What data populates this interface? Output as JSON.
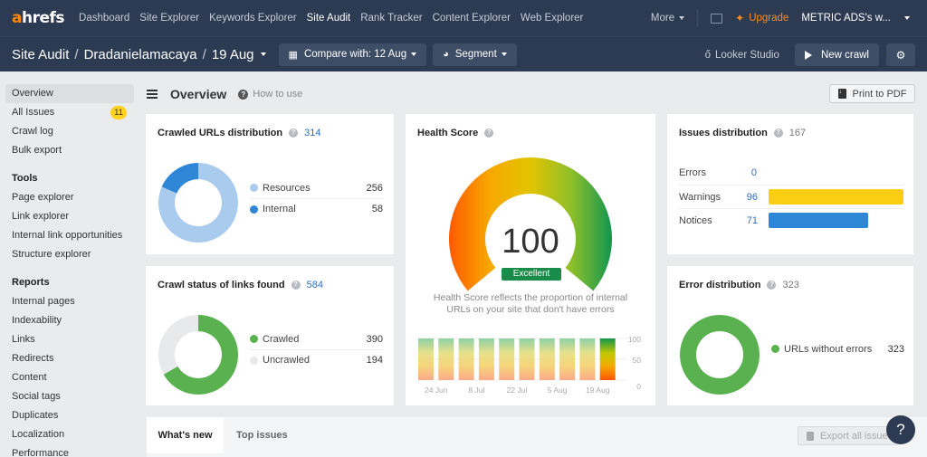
{
  "nav": {
    "logo": {
      "accent": "a",
      "rest": "hrefs"
    },
    "links": [
      "Dashboard",
      "Site Explorer",
      "Keywords Explorer",
      "Site Audit",
      "Rank Tracker",
      "Content Explorer",
      "Web Explorer"
    ],
    "active_link": "Site Audit",
    "more": "More",
    "upgrade": "Upgrade",
    "account": "METRIC ADS's w..."
  },
  "subheader": {
    "breadcrumbs": [
      "Site Audit",
      "Dradanielamacaya",
      "19 Aug"
    ],
    "compare_button": "Compare with: 12 Aug",
    "segment_button": "Segment",
    "looker_studio": "Looker Studio",
    "new_crawl_button": "New crawl"
  },
  "sidebar": {
    "items": [
      {
        "label": "Overview",
        "active": true
      },
      {
        "label": "All Issues",
        "badge": "11"
      },
      {
        "label": "Crawl log"
      },
      {
        "label": "Bulk export"
      }
    ],
    "tools_heading": "Tools",
    "tools": [
      "Page explorer",
      "Link explorer",
      "Internal link opportunities",
      "Structure explorer"
    ],
    "reports_heading": "Reports",
    "reports": [
      "Internal pages",
      "Indexability",
      "Links",
      "Redirects",
      "Content",
      "Social tags",
      "Duplicates",
      "Localization",
      "Performance"
    ]
  },
  "main": {
    "title": "Overview",
    "how_to_use": "How to use",
    "print_button": "Print to PDF"
  },
  "cards": {
    "crawled_urls": {
      "title": "Crawled URLs distribution",
      "total": "314",
      "items": [
        {
          "label": "Resources",
          "value": 256,
          "color": "#a8cbee"
        },
        {
          "label": "Internal",
          "value": 58,
          "color": "#2e86d6"
        }
      ]
    },
    "crawl_status": {
      "title": "Crawl status of links found",
      "total": "584",
      "items": [
        {
          "label": "Crawled",
          "value": 390,
          "color": "#5ab14f"
        },
        {
          "label": "Uncrawled",
          "value": 194,
          "color": "#e8e9eb"
        }
      ]
    },
    "health": {
      "title": "Health Score",
      "score": "100",
      "rating": "Excellent",
      "description": "Health Score reflects the proportion of internal URLs on your site that don't have errors"
    },
    "issues": {
      "title": "Issues distribution",
      "total": "167",
      "rows": [
        {
          "label": "Errors",
          "value": 0,
          "color": "#e84a3c"
        },
        {
          "label": "Warnings",
          "value": 96,
          "color": "#fbce14"
        },
        {
          "label": "Notices",
          "value": 71,
          "color": "#2e86d6"
        }
      ]
    },
    "errors": {
      "title": "Error distribution",
      "total": "323",
      "items": [
        {
          "label": "URLs without errors",
          "value": 323,
          "color": "#5ab14f"
        }
      ]
    }
  },
  "chart_data": {
    "type": "bar",
    "title": "Health Score history",
    "categories": [
      "",
      "24 Jun",
      "",
      "8 Jul",
      "",
      "22 Jul",
      "",
      "5 Aug",
      "",
      "19 Aug"
    ],
    "x_tick_labels": [
      "24 Jun",
      "8 Jul",
      "22 Jul",
      "5 Aug",
      "19 Aug"
    ],
    "values": [
      100,
      100,
      100,
      100,
      100,
      100,
      100,
      100,
      100,
      100
    ],
    "highlighted_index": 9,
    "y_ticks": [
      0,
      50,
      100
    ],
    "ylim": [
      0,
      100
    ],
    "grid": true
  },
  "bottom": {
    "tabs": [
      "What's new",
      "Top issues"
    ],
    "export_button": "Export all issues",
    "help": "?"
  }
}
